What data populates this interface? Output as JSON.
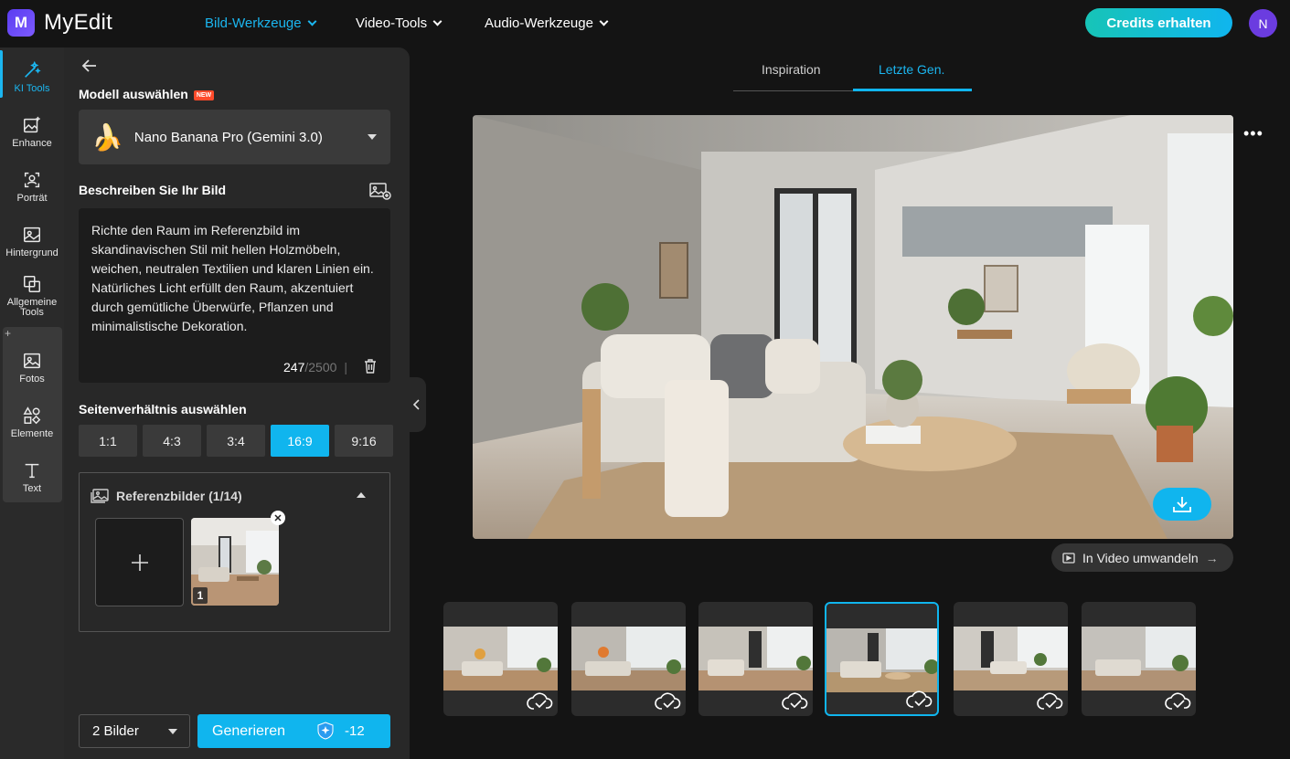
{
  "app": {
    "logo_letter": "M",
    "name": "MyEdit"
  },
  "nav": [
    {
      "label": "Bild-Werkzeuge",
      "active": true
    },
    {
      "label": "Video-Tools",
      "active": false
    },
    {
      "label": "Audio-Werkzeuge",
      "active": false
    }
  ],
  "header": {
    "credits_label": "Credits erhalten",
    "avatar_letter": "N"
  },
  "rail": [
    {
      "label": "KI Tools",
      "icon": "magic-wand-icon"
    },
    {
      "label": "Enhance",
      "icon": "enhance-icon"
    },
    {
      "label": "Porträt",
      "icon": "portrait-icon"
    },
    {
      "label": "Hintergrund",
      "icon": "background-icon"
    },
    {
      "label": "Allgemeine Tools",
      "icon": "general-tools-icon"
    },
    {
      "label": "Fotos",
      "icon": "photos-icon"
    },
    {
      "label": "Elemente",
      "icon": "elements-icon"
    },
    {
      "label": "Text",
      "icon": "text-icon"
    }
  ],
  "panel": {
    "model_label": "Modell auswählen",
    "new_badge": "NEW",
    "model_value": "Nano Banana Pro (Gemini 3.0)",
    "describe_label": "Beschreiben Sie Ihr Bild",
    "prompt_text": "Richte den Raum im Referenzbild im skandinavischen Stil mit hellen Holzmöbeln, weichen, neutralen Textilien und klaren Linien ein. Natürliches Licht erfüllt den Raum, akzentuiert durch gemütliche Überwürfe, Pflanzen und minimalistische Dekoration.",
    "char_count": "247",
    "char_max": "/2500",
    "char_sep": "|",
    "ratio_label": "Seitenverhältnis auswählen",
    "ratios": [
      "1:1",
      "4:3",
      "3:4",
      "16:9",
      "9:16"
    ],
    "ratio_selected": "16:9",
    "ref_label": "Referenzbilder (1/14)",
    "ref_thumb_number": "1",
    "count_value": "2 Bilder",
    "generate_label": "Generieren",
    "generate_cost": "-12"
  },
  "main": {
    "tabs": [
      {
        "label": "Inspiration",
        "active": false
      },
      {
        "label": "Letzte Gen.",
        "active": true
      }
    ],
    "to_video_label": "In Video umwandeln",
    "to_video_arrow": "→",
    "thumbnails_count": 6,
    "selected_thumbnail": 4
  },
  "colors": {
    "accent": "#10b5ee",
    "bg": "#141414",
    "panel": "#282828"
  }
}
